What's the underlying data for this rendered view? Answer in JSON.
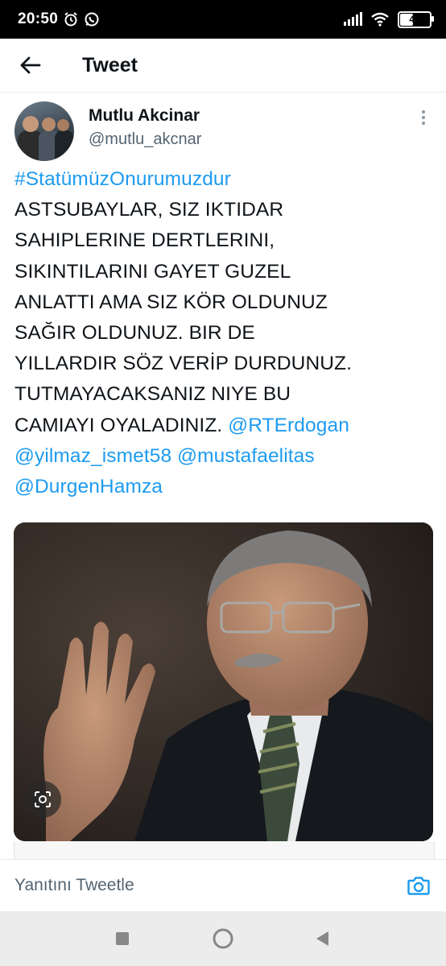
{
  "status_bar": {
    "time": "20:50",
    "battery": "41",
    "battery_level": 0.41
  },
  "header": {
    "title": "Tweet"
  },
  "tweet": {
    "author_name": "Mutlu Akcinar",
    "author_handle": "@mutlu_akcnar",
    "hashtag": "#StatümüzOnurumuzdur",
    "lines": [
      "ASTSUBAYLAR, SIZ IKTIDAR",
      "SAHIPLERINE DERTLERINI,",
      "SIKINTILARINI GAYET GUZEL",
      "ANLATTI AMA SIZ KÖR OLDUNUZ",
      "SAĞIR OLDUNUZ. BIR DE",
      "YILLARDIR SÖZ VERİP DURDUNUZ.",
      "TUTMAYACAKSANIZ NIYE BU",
      "CAMIAYI OYALADINIZ."
    ],
    "mentions": [
      "@RTErdogan",
      "@yilmaz_ismet58",
      "@mustafaelitas",
      "@DurgenHamza"
    ]
  },
  "reply": {
    "placeholder": "Yanıtını Tweetle"
  },
  "colors": {
    "link": "#1d9bf0",
    "text": "#0f1419",
    "secondary": "#536471"
  },
  "icons": {
    "back": "arrow-left-icon",
    "more": "more-vertical-icon",
    "lens": "google-lens-icon",
    "camera": "camera-icon",
    "nav_recents": "square-icon",
    "nav_home": "circle-icon",
    "nav_back": "triangle-back-icon"
  }
}
